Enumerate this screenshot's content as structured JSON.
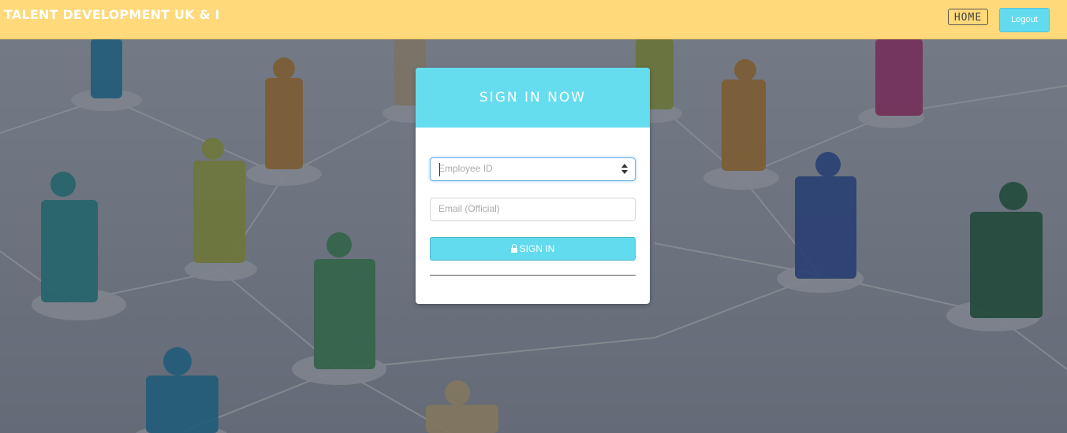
{
  "header": {
    "brand": "TALENT DEVELOPMENT UK & I",
    "home_label": "HOME",
    "logout_label": "Logout"
  },
  "login": {
    "title": "SIGN IN NOW",
    "employee_id": {
      "value": "",
      "placeholder": "Employee ID"
    },
    "email": {
      "value": "",
      "placeholder": "Email (Official)"
    },
    "submit_label": "SIGN IN"
  },
  "colors": {
    "header_bg": "#ffd97a",
    "accent": "#66dcef",
    "page_bg": "#5d6470"
  },
  "icons": {
    "submit": "lock-icon",
    "employee_id_stepper": "number-spinner-icon"
  }
}
